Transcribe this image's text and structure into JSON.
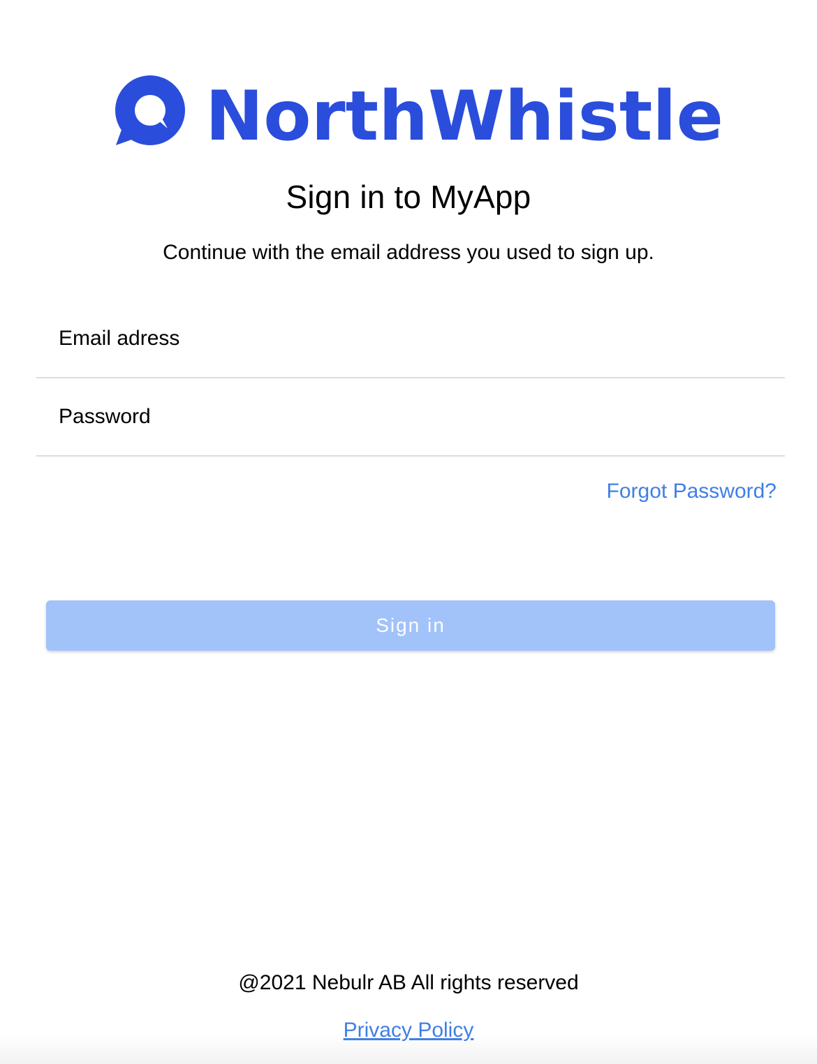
{
  "brand": {
    "name": "NorthWhistle",
    "color": "#2a4ddb",
    "logo_icon": "speech-bubble-icon"
  },
  "heading": {
    "title": "Sign in to MyApp",
    "subtitle": "Continue with the email address you used to sign up."
  },
  "form": {
    "email_placeholder": "Email adress",
    "email_value": "",
    "password_placeholder": "Password",
    "password_value": "",
    "forgot_label": "Forgot Password?",
    "submit_label": "Sign in",
    "submit_color": "#a2c2fa",
    "link_color": "#3f7fe6"
  },
  "footer": {
    "copyright": "@2021 Nebulr AB All rights reserved",
    "privacy_label": "Privacy Policy"
  }
}
